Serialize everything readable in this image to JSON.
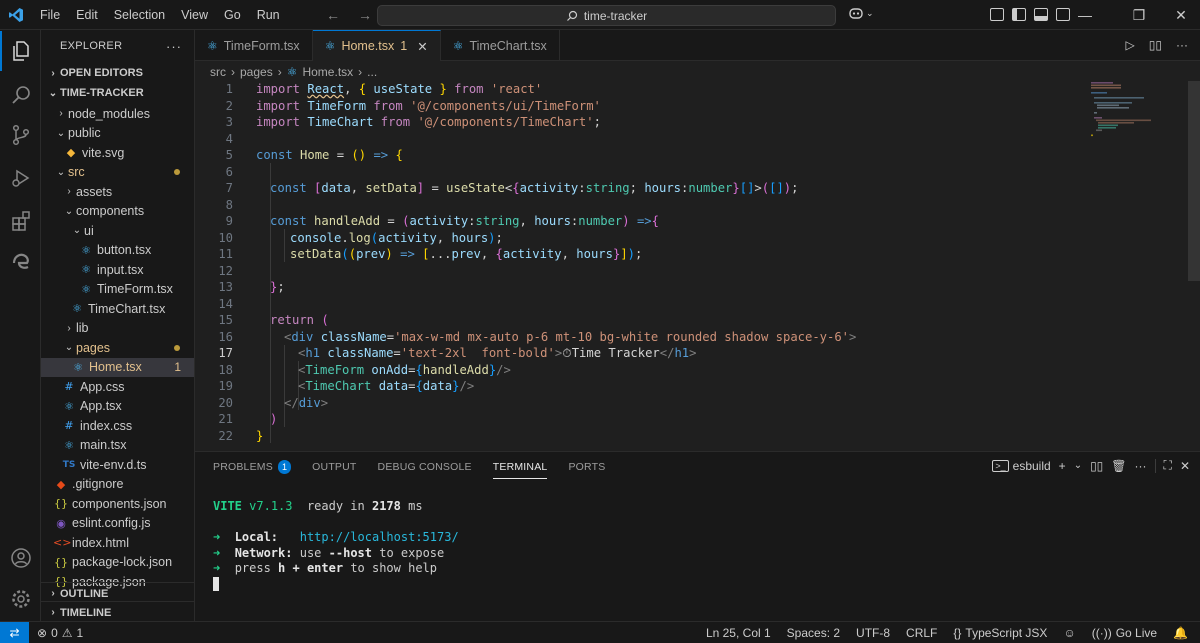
{
  "titlebar": {
    "menu": [
      "File",
      "Edit",
      "Selection",
      "View",
      "Go",
      "Run"
    ],
    "search_text": "time-tracker"
  },
  "explorer": {
    "title": "EXPLORER",
    "open_editors": "OPEN EDITORS",
    "project": "TIME-TRACKER",
    "tree": [
      {
        "label": "node_modules",
        "type": "folder"
      },
      {
        "label": "public",
        "type": "folder"
      },
      {
        "label": "vite.svg",
        "type": "file"
      },
      {
        "label": "src",
        "type": "folder"
      },
      {
        "label": "assets",
        "type": "folder"
      },
      {
        "label": "components",
        "type": "folder"
      },
      {
        "label": "ui",
        "type": "folder"
      },
      {
        "label": "button.tsx",
        "type": "file"
      },
      {
        "label": "input.tsx",
        "type": "file"
      },
      {
        "label": "TimeForm.tsx",
        "type": "file"
      },
      {
        "label": "TimeChart.tsx",
        "type": "file"
      },
      {
        "label": "lib",
        "type": "folder"
      },
      {
        "label": "pages",
        "type": "folder"
      },
      {
        "label": "Home.tsx",
        "type": "file",
        "problems": "1"
      },
      {
        "label": "App.css",
        "type": "file"
      },
      {
        "label": "App.tsx",
        "type": "file"
      },
      {
        "label": "index.css",
        "type": "file"
      },
      {
        "label": "main.tsx",
        "type": "file"
      },
      {
        "label": "vite-env.d.ts",
        "type": "file"
      },
      {
        "label": ".gitignore",
        "type": "file"
      },
      {
        "label": "components.json",
        "type": "file"
      },
      {
        "label": "eslint.config.js",
        "type": "file"
      },
      {
        "label": "index.html",
        "type": "file"
      },
      {
        "label": "package-lock.json",
        "type": "file"
      },
      {
        "label": "package.json",
        "type": "file"
      }
    ],
    "outline": "OUTLINE",
    "timeline": "TIMELINE"
  },
  "tabs": [
    {
      "label": "TimeForm.tsx",
      "active": false
    },
    {
      "label": "Home.tsx",
      "active": true,
      "problems": "1"
    },
    {
      "label": "TimeChart.tsx",
      "active": false
    }
  ],
  "breadcrumbs": [
    "src",
    "pages",
    "Home.tsx",
    "..."
  ],
  "line_numbers": [
    "1",
    "2",
    "3",
    "4",
    "5",
    "6",
    "7",
    "8",
    "9",
    "10",
    "11",
    "12",
    "13",
    "14",
    "15",
    "16",
    "17",
    "18",
    "19",
    "20",
    "21",
    "22"
  ],
  "code_text": {
    "l1": "import React, { useState } from 'react'",
    "l2": "import TimeForm from '@/components/ui/TimeForm'",
    "l3": "import TimeChart from '@/components/TimeChart';",
    "l5": "const Home = () => {",
    "l7": "const [data, setData] = useState<{activity:string; hours:number}[]>([]);",
    "l9": "const handleAdd = (activity:string, hours:number) =>{",
    "l10": "console.log(activity, hours);",
    "l11": "setData((prev) => [...prev, {activity, hours}]);",
    "l13": "};",
    "l15": "return (",
    "l16": "<div className='max-w-md mx-auto p-6 mt-10 bg-white rounded shadow space-y-6'>",
    "l17": "<h1 className='text-2xl  font-bold'>⏱Time Tracker</h1>",
    "l18": "<TimeForm onAdd={handleAdd}/>",
    "l19": "<TimeChart data={data}/>",
    "l20": "</div>",
    "l21": ")",
    "l22": "}"
  },
  "panel": {
    "tabs": [
      "PROBLEMS",
      "OUTPUT",
      "DEBUG CONSOLE",
      "TERMINAL",
      "PORTS"
    ],
    "problems_count": "1",
    "active_tab": "TERMINAL",
    "terminal_name": "esbuild"
  },
  "terminal": {
    "vite_label": "VITE",
    "vite_version": "v7.1.3",
    "ready_text": "ready in",
    "ready_ms": "2178",
    "ms": "ms",
    "local_label": "Local:",
    "local_url": "http://localhost:5173/",
    "network_label": "Network:",
    "network_text": "use",
    "network_flag": "--host",
    "network_tail": "to expose",
    "help_pre": "press",
    "help_key": "h + enter",
    "help_tail": "to show help"
  },
  "statusbar": {
    "errors": "0",
    "warnings": "1",
    "position": "Ln 25, Col 1",
    "spaces": "Spaces: 2",
    "encoding": "UTF-8",
    "eol": "CRLF",
    "language": "TypeScript JSX",
    "golive": "Go Live"
  },
  "colors": {
    "accent": "#0078d4",
    "modified": "#e2c08d"
  }
}
